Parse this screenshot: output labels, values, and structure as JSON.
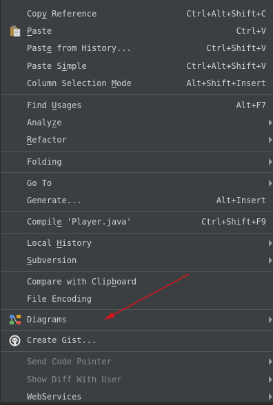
{
  "menu": {
    "items": [
      {
        "label_pre": "Cop",
        "label_u": "y",
        "label_post": " Reference",
        "shortcut": "Ctrl+Alt+Shift+C"
      },
      {
        "label_pre": "",
        "label_u": "P",
        "label_post": "aste",
        "shortcut": "Ctrl+V"
      },
      {
        "label_pre": "Past",
        "label_u": "e",
        "label_post": " from History...",
        "shortcut": "Ctrl+Shift+V"
      },
      {
        "label_pre": "Paste S",
        "label_u": "i",
        "label_post": "mple",
        "shortcut": "Ctrl+Alt+Shift+V"
      },
      {
        "label_pre": "Column Selection ",
        "label_u": "M",
        "label_post": "ode",
        "shortcut": "Alt+Shift+Insert"
      },
      {
        "label_pre": "Find ",
        "label_u": "U",
        "label_post": "sages",
        "shortcut": "Alt+F7"
      },
      {
        "label_pre": "Analy",
        "label_u": "z",
        "label_post": "e",
        "shortcut": ""
      },
      {
        "label_pre": "",
        "label_u": "R",
        "label_post": "efactor",
        "shortcut": ""
      },
      {
        "label_pre": "Folding",
        "label_u": "",
        "label_post": "",
        "shortcut": ""
      },
      {
        "label_pre": "Go To",
        "label_u": "",
        "label_post": "",
        "shortcut": ""
      },
      {
        "label_pre": "Generate...",
        "label_u": "",
        "label_post": "",
        "shortcut": "Alt+Insert"
      },
      {
        "label_pre": "Compil",
        "label_u": "e",
        "label_post": " 'Player.java'",
        "shortcut": "Ctrl+Shift+F9"
      },
      {
        "label_pre": "Local ",
        "label_u": "H",
        "label_post": "istory",
        "shortcut": ""
      },
      {
        "label_pre": "",
        "label_u": "S",
        "label_post": "ubversion",
        "shortcut": ""
      },
      {
        "label_pre": "Compare with Clip",
        "label_u": "b",
        "label_post": "oard",
        "shortcut": ""
      },
      {
        "label_pre": "File Encoding",
        "label_u": "",
        "label_post": "",
        "shortcut": ""
      },
      {
        "label_pre": "Diagrams",
        "label_u": "",
        "label_post": "",
        "shortcut": ""
      },
      {
        "label_pre": "Create Gist...",
        "label_u": "",
        "label_post": "",
        "shortcut": ""
      },
      {
        "label_pre": "Send Code Pointer",
        "label_u": "",
        "label_post": "",
        "shortcut": ""
      },
      {
        "label_pre": "Show Diff With User",
        "label_u": "",
        "label_post": "",
        "shortcut": ""
      },
      {
        "label_pre": "WebServices",
        "label_u": "",
        "label_post": "",
        "shortcut": ""
      }
    ]
  },
  "icons": {
    "paste": "paste-icon",
    "diagrams": "diagram-icon",
    "gist": "github-octocat-icon",
    "submenu": "chevron-right-icon"
  },
  "colors": {
    "menu_background": "#3c3f41",
    "text": "#d0d0d0",
    "disabled_text": "#8a8a8a",
    "separator": "#555859",
    "annotation_arrow": "#d4141c"
  }
}
